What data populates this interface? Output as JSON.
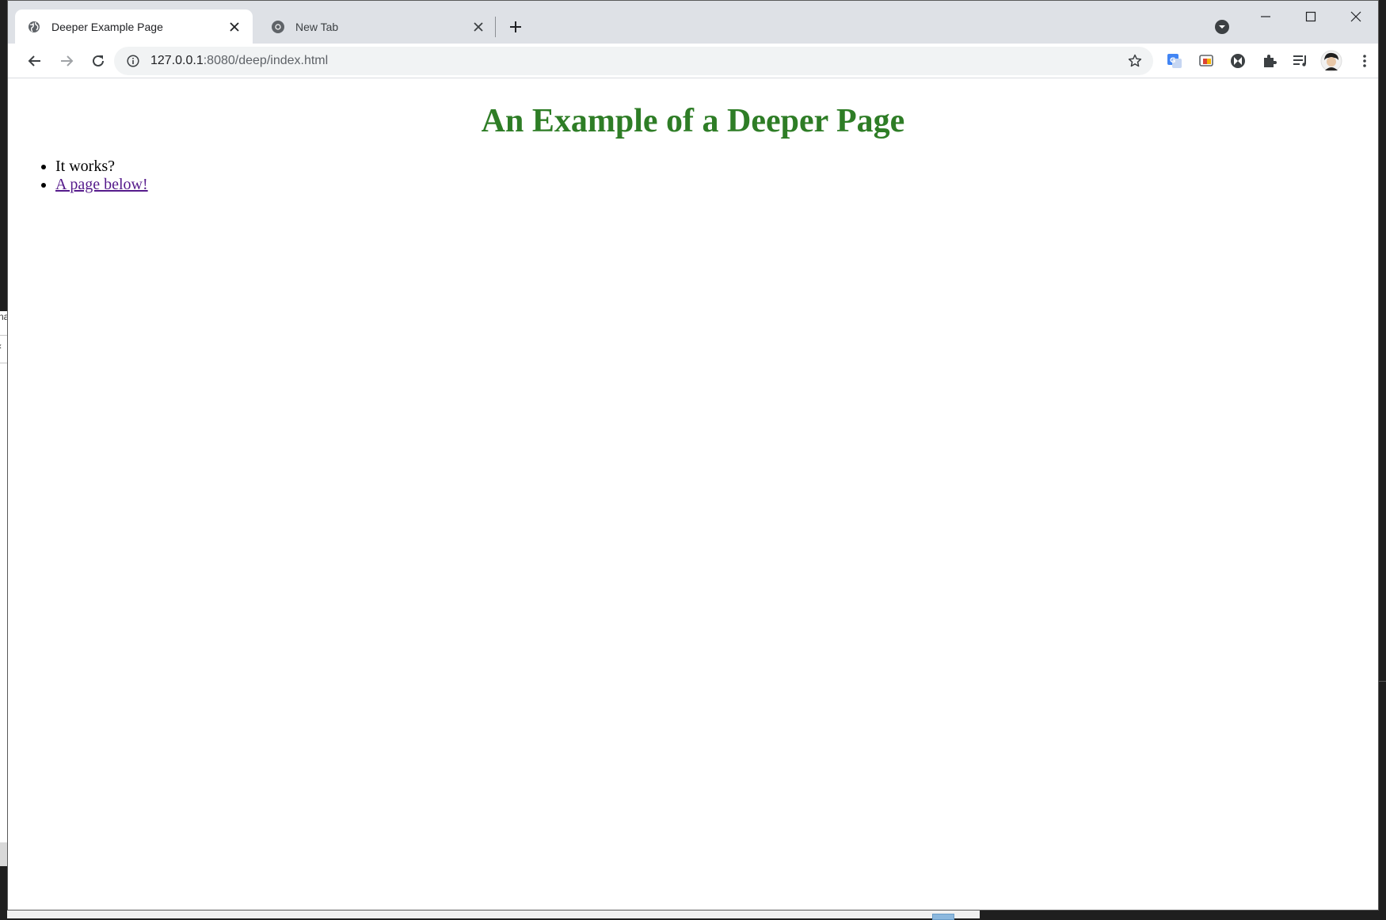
{
  "browser": {
    "tabs": [
      {
        "title": "Deeper Example Page",
        "active": true,
        "icon": "globe-icon"
      },
      {
        "title": "New Tab",
        "active": false,
        "icon": "chrome-icon"
      }
    ],
    "address": {
      "host": "127.0.0.1",
      "path": ":8080/deep/index.html"
    },
    "extensions": [
      "google-translate-icon",
      "cast-icon",
      "media-extension-icon",
      "extensions-puzzle-icon",
      "reading-list-icon",
      "profile-avatar",
      "menu-icon"
    ],
    "colors": {
      "titlebar": "#dee1e6",
      "omnibox": "#f1f3f4"
    }
  },
  "page": {
    "heading": "An Example of a Deeper Page",
    "heading_color": "#2e7d26",
    "items": [
      {
        "text": "It works?"
      },
      {
        "text": "A page below!",
        "link": true
      }
    ]
  },
  "background": {
    "left_fragment_1": "na",
    "left_fragment_2": "‹"
  }
}
